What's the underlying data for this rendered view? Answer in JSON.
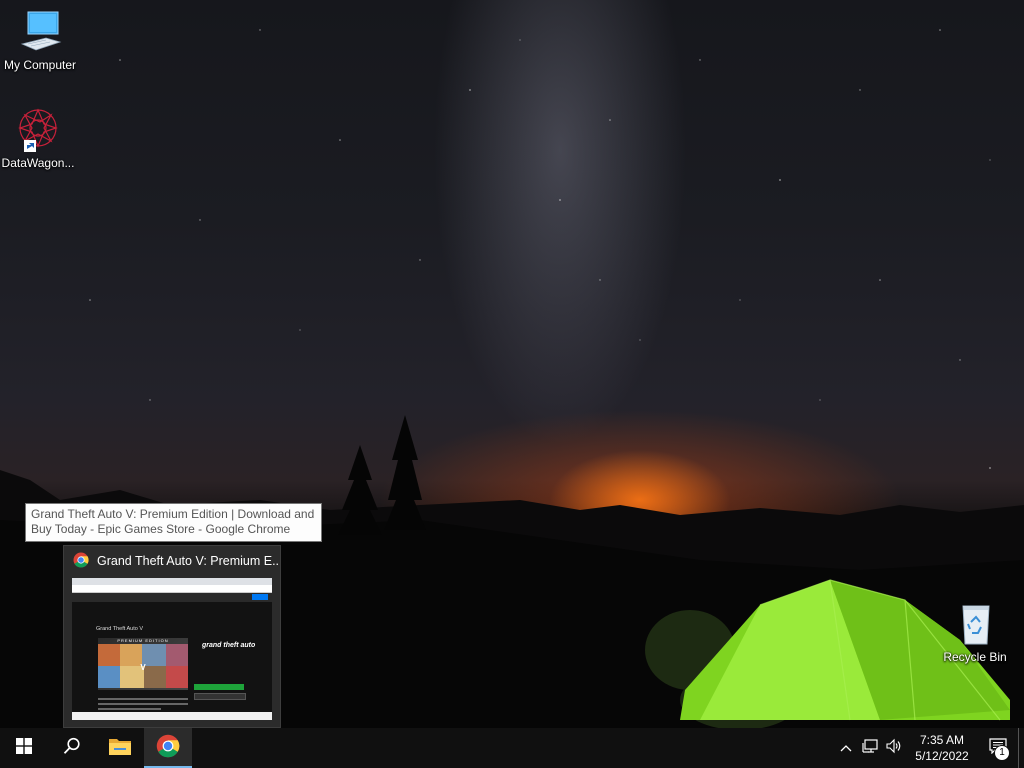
{
  "desktop": {
    "icons": [
      {
        "label": "My Computer",
        "icon": "computer-icon"
      },
      {
        "label": "DataWagon...",
        "icon": "datawagon-shortcut-icon"
      },
      {
        "label": "Recycle Bin",
        "icon": "recycle-bin-icon"
      }
    ]
  },
  "tooltip": {
    "text": "Grand Theft Auto V: Premium Edition | Download and Buy Today - Epic Games Store - Google Chrome"
  },
  "thumbnail": {
    "title": "Grand Theft Auto V: Premium E...",
    "icon": "chrome-icon",
    "preview": {
      "heading": "Grand Theft Auto V",
      "cover_text": "PREMIUM EDITION",
      "logo_text": "grand theft auto"
    }
  },
  "taskbar": {
    "buttons": [
      {
        "name": "start",
        "icon": "windows-icon"
      },
      {
        "name": "search",
        "icon": "search-icon"
      },
      {
        "name": "file-explorer",
        "icon": "folder-icon"
      },
      {
        "name": "google-chrome",
        "icon": "chrome-icon",
        "active": true
      }
    ],
    "tray": {
      "icons": [
        "chevron-up-icon",
        "network-icon",
        "volume-icon"
      ],
      "time": "7:35 AM",
      "date": "5/12/2022",
      "notification_count": "1"
    }
  },
  "colors": {
    "taskbar_bg": "#101010",
    "active_indicator": "#76b9ed",
    "epic_buy_green": "#1ea43a",
    "tent_green": "#8fe02a"
  }
}
